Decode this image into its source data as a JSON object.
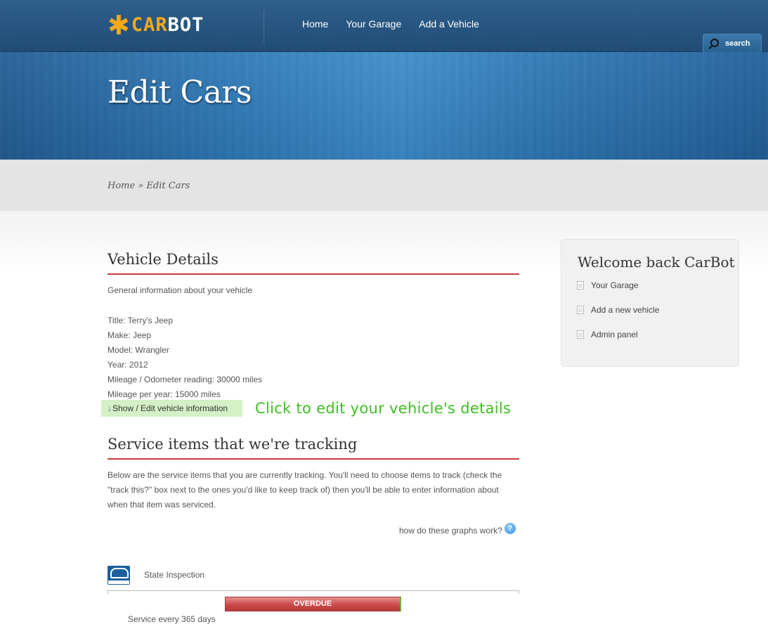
{
  "header": {
    "logo_part1": "CAR",
    "logo_part2": "BOT",
    "nav": [
      "Home",
      "Your Garage",
      "Add a Vehicle"
    ],
    "search_label": "search"
  },
  "banner": {
    "title": "Edit Cars"
  },
  "breadcrumb": {
    "home": "Home",
    "separator": "»",
    "current": "Edit Cars"
  },
  "vehicle_details": {
    "heading": "Vehicle Details",
    "intro": "General information about your vehicle",
    "fields": [
      "Title: Terry's Jeep",
      "Make: Jeep",
      "Model: Wrangler",
      "Year: 2012",
      "Mileage / Odometer reading: 30000 miles",
      "Mileage per year: 15000 miles"
    ],
    "toggle_label": "Show / Edit vehicle information",
    "edit_hint": "Click to edit your vehicle's details"
  },
  "service": {
    "heading": "Service items that we're tracking",
    "intro": "Below are the service items that you are currently tracking. You'll need to choose items to track (check the \"track this?\" box next to the ones you'd like to keep track of) then you'll be able to enter information about when that item was serviced.",
    "graphs_help": "how do these graphs work?",
    "items": [
      {
        "name": "State Inspection",
        "status": "OVERDUE",
        "interval": "Service every 365 days"
      }
    ]
  },
  "sidebar": {
    "title": "Welcome back CarBot",
    "links": [
      "Your Garage",
      "Add a new vehicle",
      "Admin panel"
    ]
  },
  "colors": {
    "header_blue": "#1e4a74",
    "accent_orange": "#f5a81c",
    "heading_rule_red": "#c93a3a",
    "hint_green": "#3fbe22",
    "overdue_red": "#cc4a4a"
  }
}
